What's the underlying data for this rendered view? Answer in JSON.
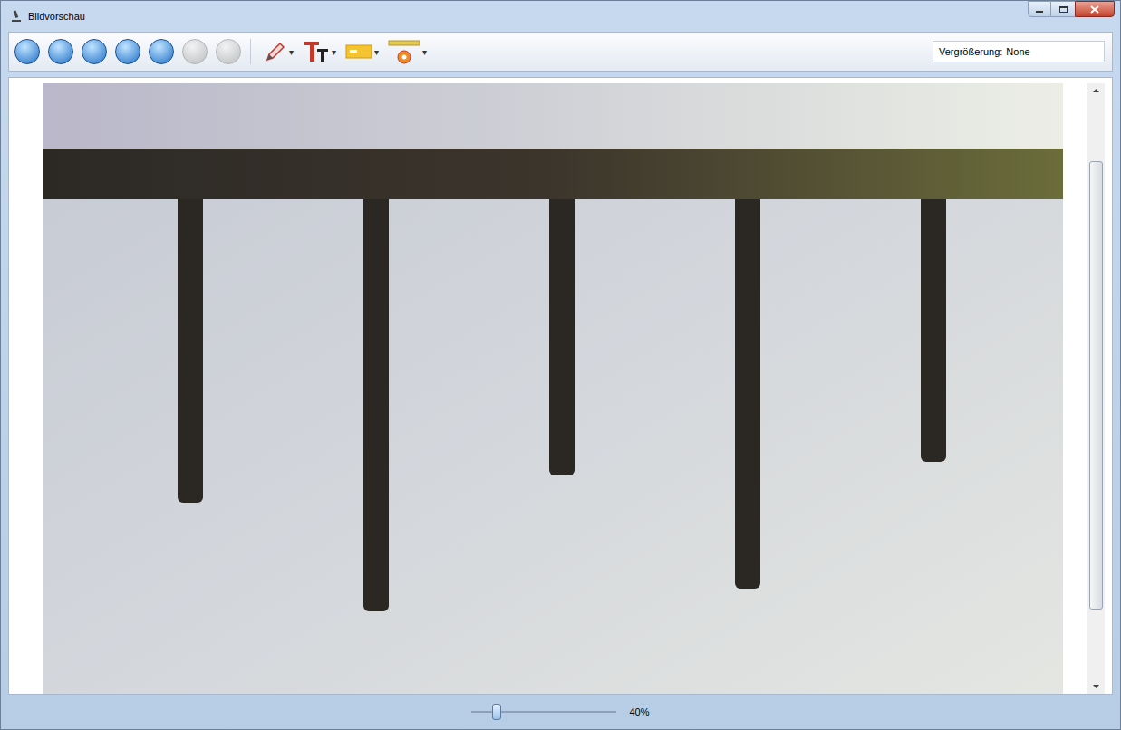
{
  "window": {
    "title": "Bildvorschau"
  },
  "toolbar": {
    "buttons": [
      {
        "disabled": false
      },
      {
        "disabled": false
      },
      {
        "disabled": false
      },
      {
        "disabled": false
      },
      {
        "disabled": false
      },
      {
        "disabled": true
      },
      {
        "disabled": true
      }
    ],
    "tools": [
      {
        "arrow": "▾"
      },
      {
        "arrow": "▾"
      },
      {
        "arrow": "▾"
      },
      {
        "arrow": "▾"
      }
    ]
  },
  "magnification": {
    "label": "Vergrößerung:",
    "value": "None"
  },
  "scrollbar": {
    "offset": 0.11,
    "size": 0.77
  },
  "zoom": {
    "level": 0.17,
    "reading": "40%"
  }
}
